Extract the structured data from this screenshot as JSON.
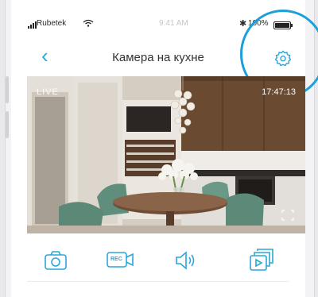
{
  "status_bar": {
    "carrier": "Rubetek",
    "time": "9:41 AM",
    "battery_percent": "100%",
    "battery_level": 1.0,
    "icons": [
      "signal-icon",
      "wifi-icon",
      "bluetooth-icon",
      "battery-icon"
    ]
  },
  "nav": {
    "back_icon": "chevron-left-icon",
    "title": "Камера на кухне",
    "settings_icon": "gear-icon"
  },
  "camera": {
    "live_label": "LIVE",
    "timestamp": "17:47:13",
    "fullscreen_icon": "fullscreen-icon"
  },
  "controls": {
    "items": [
      {
        "icon": "camera-icon"
      },
      {
        "icon": "record-icon",
        "label": "REC"
      },
      {
        "icon": "speaker-icon"
      },
      {
        "icon": "gallery-icon"
      }
    ]
  },
  "colors": {
    "accent": "#29a8d8",
    "highlight_ring": "#1aa0db"
  }
}
